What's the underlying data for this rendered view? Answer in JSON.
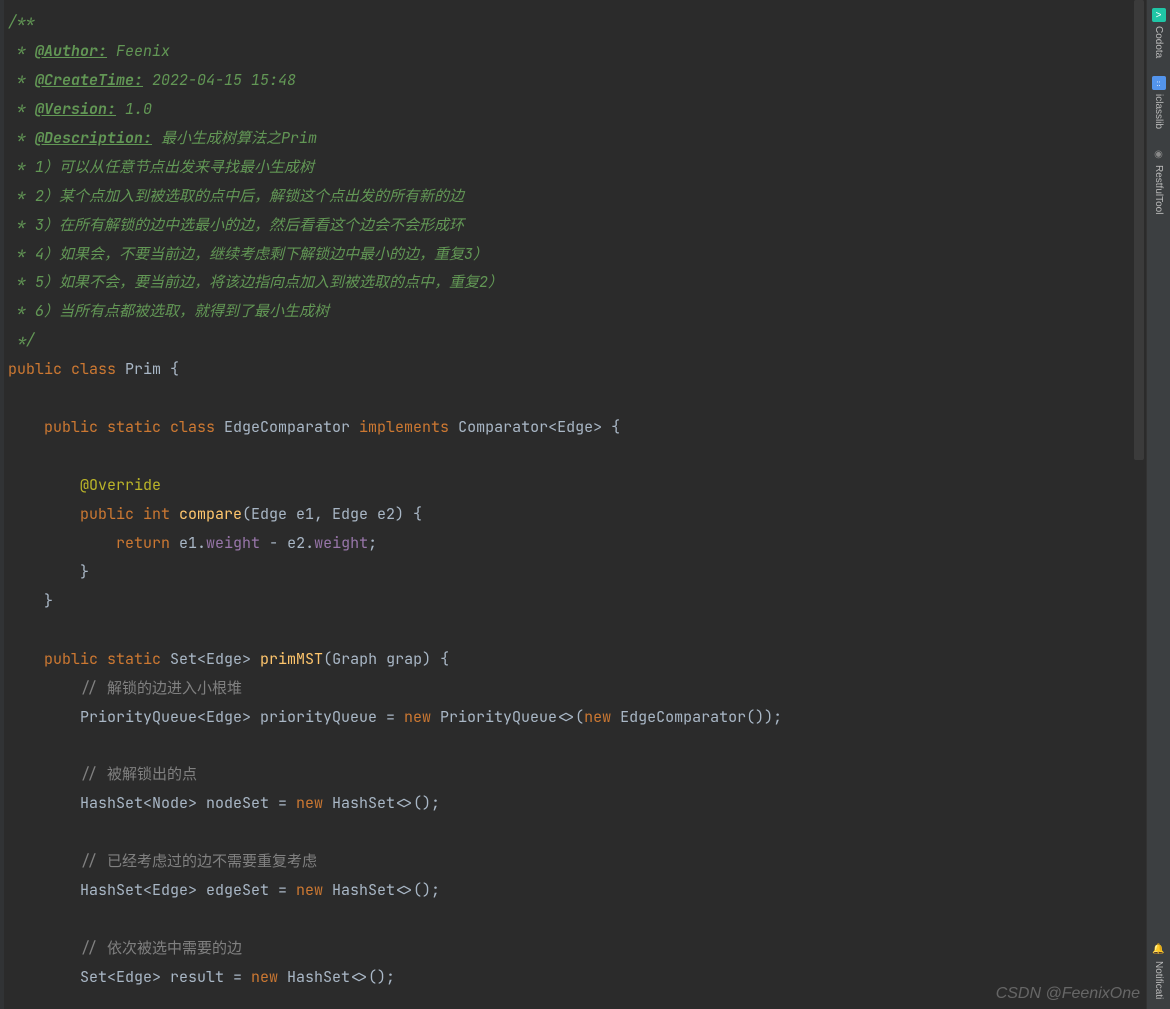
{
  "doc": {
    "author_tag": "@Author:",
    "author_val": " Feenix",
    "create_tag": "@CreateTime:",
    "create_val": " 2022-04-15 15:48",
    "version_tag": "@Version:",
    "version_val": " 1.0",
    "desc_tag": "@Description:",
    "desc_val": " 最小生成树算法之Prim",
    "line1": " * 1）可以从任意节点出发来寻找最小生成树",
    "line2": " * 2）某个点加入到被选取的点中后，解锁这个点出发的所有新的边",
    "line3": " * 3）在所有解锁的边中选最小的边，然后看看这个边会不会形成环",
    "line4": " * 4）如果会，不要当前边，继续考虑剩下解锁边中最小的边，重复3）",
    "line5": " * 5）如果不会，要当前边，将该边指向点加入到被选取的点中，重复2）",
    "line6": " * 6）当所有点都被选取，就得到了最小生成树"
  },
  "code": {
    "class_decl_kw": "public class ",
    "class_name": "Prim {",
    "inner_class_kw": "public static class ",
    "inner_class_name": "EdgeComparator ",
    "implements_kw": "implements ",
    "comparator": "Comparator<Edge> {",
    "override": "@Override",
    "compare_kw": "public int ",
    "compare_name": "compare",
    "compare_params": "(Edge e1, Edge e2) {",
    "return_kw": "return ",
    "ret_e1": "e1.",
    "weight1": "weight",
    "ret_mid": " - e2.",
    "weight2": "weight",
    "semi": ";",
    "close1": "}",
    "close2": "}",
    "prim_kw": "public static ",
    "prim_ret": "Set<Edge> ",
    "prim_name": "primMST",
    "prim_params": "(Graph grap) {",
    "c1": "// 解锁的边进入小根堆",
    "pq_decl": "PriorityQueue<Edge> priorityQueue = ",
    "new_kw": "new ",
    "pq_ctor": "PriorityQueue<>(",
    "new_kw2": "new ",
    "edge_comp": "EdgeComparator());",
    "c2": "// 被解锁出的点",
    "ns_decl": "HashSet<Node> nodeSet = ",
    "hashset1": "HashSet<>();",
    "c3": "// 已经考虑过的边不需要重复考虑",
    "es_decl": "HashSet<Edge> edgeSet = ",
    "hashset2": "HashSet<>();",
    "c4": "// 依次被选中需要的边",
    "res_decl": "Set<Edge> result = ",
    "hashset3": "HashSet<>();"
  },
  "sidebar": {
    "codota": "Codota",
    "iclasslib": "iclasslib",
    "restful": "RestfulTool",
    "notif": "Notificati"
  },
  "watermark": "CSDN @FeenixOne"
}
